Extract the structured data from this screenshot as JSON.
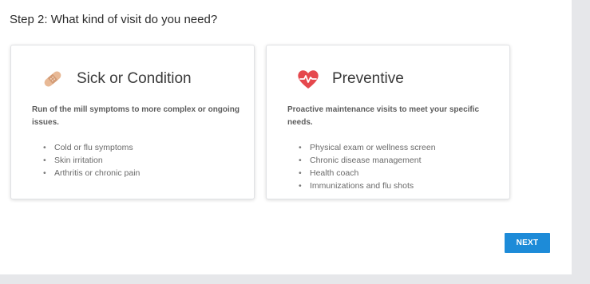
{
  "step": {
    "title": "Step 2: What kind of visit do you need?"
  },
  "cards": [
    {
      "title": "Sick or Condition",
      "icon": "bandage-icon",
      "description": "Run of the mill symptoms to more complex or ongoing issues.",
      "items": [
        "Cold or flu symptoms",
        "Skin irritation",
        "Arthritis or chronic pain"
      ]
    },
    {
      "title": "Preventive",
      "icon": "heart-pulse-icon",
      "description": "Proactive maintenance visits to meet your specific needs.",
      "items": [
        "Physical exam or wellness screen",
        "Chronic disease management",
        "Health coach",
        "Immunizations and flu shots"
      ]
    }
  ],
  "actions": {
    "next_label": "NEXT"
  },
  "colors": {
    "accent": "#1d8bd8",
    "heart": "#e5484d",
    "bandage": "#e8b996"
  }
}
